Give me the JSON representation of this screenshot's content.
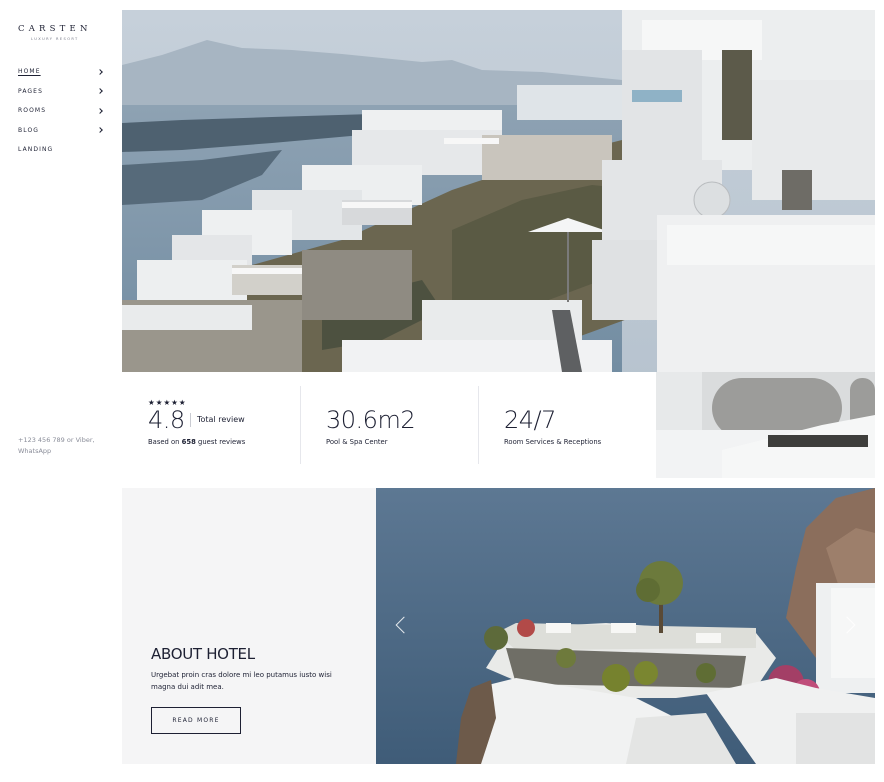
{
  "brand": {
    "name": "CARSTEN",
    "tagline": "LUXURY RESORT"
  },
  "nav": {
    "items": [
      {
        "label": "HOME",
        "active": true,
        "has_submenu": true
      },
      {
        "label": "PAGES",
        "active": false,
        "has_submenu": true
      },
      {
        "label": "ROOMS",
        "active": false,
        "has_submenu": true
      },
      {
        "label": "BLOG",
        "active": false,
        "has_submenu": true
      },
      {
        "label": "LANDING",
        "active": false,
        "has_submenu": false
      }
    ]
  },
  "contact": {
    "text": "+123 456 789 or Viber, WhatsApp"
  },
  "stats": {
    "rating": {
      "stars": "★★★★★",
      "value": "4.8",
      "label": "Total review",
      "based_on_prefix": "Based on",
      "review_count": "658",
      "based_on_suffix": "guest reviews"
    },
    "spa": {
      "value": "30.6m2",
      "label": "Pool & Spa Center"
    },
    "service": {
      "value": "24/7",
      "label": "Room Services & Receptions"
    }
  },
  "about": {
    "title": "ABOUT HOTEL",
    "text": "Urgebat proin cras dolore mi leo putamus iusto wisi magna dui adit mea.",
    "button_label": "READ MORE"
  },
  "icons": {
    "submenu": "chevron-right-icon",
    "rating": "star-icon",
    "slider_prev": "chevron-left-icon",
    "slider_next": "chevron-right-icon"
  },
  "colors": {
    "text": "#1d2033",
    "muted": "#8a8d99",
    "panel": "#f5f5f6",
    "accent": "#1d2033"
  }
}
